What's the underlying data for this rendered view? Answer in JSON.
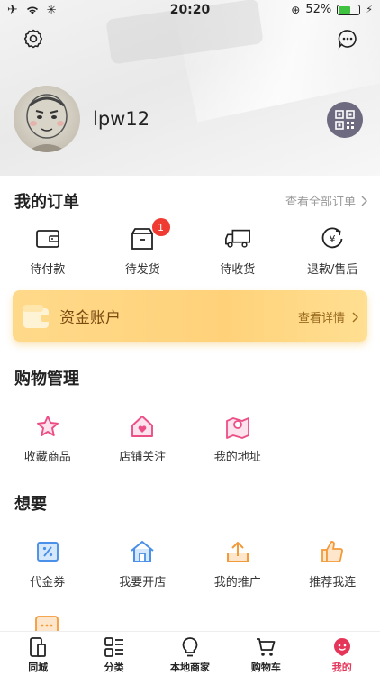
{
  "status_bar": {
    "time": "20:20",
    "battery": "52%",
    "battery_level": 0.52
  },
  "profile": {
    "username": "lpw12"
  },
  "orders": {
    "title": "我的订单",
    "view_all": "查看全部订单",
    "items": [
      {
        "label": "待付款",
        "icon": "wallet-icon"
      },
      {
        "label": "待发货",
        "icon": "box-icon",
        "badge": "1"
      },
      {
        "label": "待收货",
        "icon": "truck-icon"
      },
      {
        "label": "退款/售后",
        "icon": "refund-icon"
      }
    ]
  },
  "fund": {
    "title": "资金账户",
    "detail": "查看详情"
  },
  "shopping": {
    "title": "购物管理",
    "items": [
      {
        "label": "收藏商品",
        "icon": "star-icon"
      },
      {
        "label": "店铺关注",
        "icon": "shop-heart-icon"
      },
      {
        "label": "我的地址",
        "icon": "map-pin-icon"
      }
    ]
  },
  "want": {
    "title": "想要",
    "items": [
      {
        "label": "代金券",
        "icon": "coupon-icon"
      },
      {
        "label": "我要开店",
        "icon": "store-icon"
      },
      {
        "label": "我的推广",
        "icon": "share-upload-icon"
      },
      {
        "label": "推荐我连",
        "icon": "thumbs-up-icon"
      }
    ]
  },
  "tabbar": {
    "items": [
      {
        "label": "同城",
        "icon": "phone-icon"
      },
      {
        "label": "分类",
        "icon": "category-icon"
      },
      {
        "label": "本地商家",
        "icon": "bulb-icon"
      },
      {
        "label": "购物车",
        "icon": "cart-icon"
      },
      {
        "label": "我的",
        "icon": "mine-icon",
        "active": true
      }
    ]
  },
  "colors": {
    "accent": "#e5365a",
    "badge": "#ef3b32",
    "fund_gradient_start": "#ffd98a",
    "pink_icon": "#ec4f86",
    "blue_icon": "#4a90e8",
    "orange_icon": "#f39a3a"
  }
}
